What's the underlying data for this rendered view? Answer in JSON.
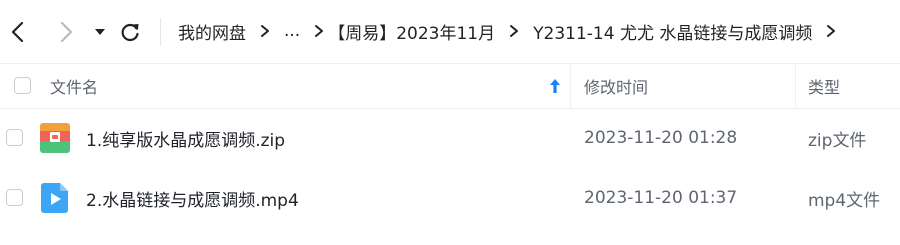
{
  "toolbar": {
    "back_icon": "chevron-left-icon",
    "forward_icon": "chevron-right-icon",
    "history_icon": "caret-down-icon",
    "refresh_icon": "refresh-icon"
  },
  "breadcrumb": {
    "items": [
      "我的网盘",
      "...",
      "【周易】2023年11月",
      "Y2311-14 尤尤 水晶链接与成愿调频"
    ],
    "separator_icon": "chevron-right-icon"
  },
  "table": {
    "headers": {
      "name": "文件名",
      "modified": "修改时间",
      "type": "类型"
    },
    "sort_icon": "arrow-up-icon",
    "sort_color": "#1a82f6",
    "rows": [
      {
        "name": "1.纯享版水晶成愿调频.zip",
        "modified": "2023-11-20 01:28",
        "type": "zip文件",
        "icon": "zip-archive-icon"
      },
      {
        "name": "2.水晶链接与成愿调频.mp4",
        "modified": "2023-11-20 01:37",
        "type": "mp4文件",
        "icon": "video-file-icon"
      }
    ]
  },
  "colors": {
    "text_primary": "#1f2329",
    "text_secondary": "#5f6670",
    "video_icon_blue": "#3da5f5",
    "zip_orange": "#f2a13a",
    "zip_red": "#f0645a",
    "zip_green": "#4ec27a"
  }
}
